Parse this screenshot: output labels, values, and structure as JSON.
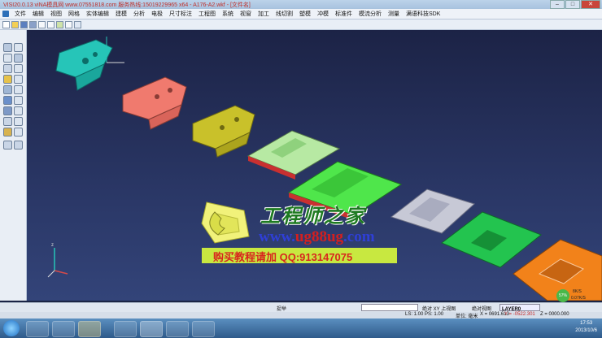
{
  "window": {
    "title": "VISI20.0.13 viNA模具网 www.07551818.com 服务热线:15019229965 x64 - A176-A2.wkf - [文件名]"
  },
  "menu": [
    "文件",
    "编辑",
    "视图",
    "网格",
    "实体编辑",
    "建模",
    "分析",
    "电极",
    "尺寸标注",
    "工程图",
    "系统",
    "视窗",
    "加工",
    "线切割",
    "塑模",
    "冲模",
    "标准件",
    "模流分析",
    "测量",
    "满语科技SDK"
  ],
  "watermark": {
    "title": "工程师之家",
    "url_prefix": "www.",
    "url_highlight": "ug88ug",
    "url_suffix": ".com",
    "banner": "购买教程请加 QQ:913147075"
  },
  "status": {
    "mode": "捉举",
    "view_label": "绝对 XY 上视图",
    "ls": "LS: 1.00 PS: 1.00",
    "abs_view": "绝对视图",
    "layer": "LAYER0",
    "units": "单位: 毫米",
    "coord_x": "X = 0691.613",
    "coord_y": "Y = -0522.301",
    "coord_z": "Z = 0000.000"
  },
  "perf": {
    "cpu": "57%",
    "up": "8K/S",
    "down": "0.07K/S"
  },
  "taskbar": {
    "time": "17:53",
    "date": "2013/10/6"
  },
  "colors": {
    "part1": "#26c5b8",
    "part2": "#f07a6e",
    "part3": "#c9c12a",
    "part4": "#b7e9a3",
    "part5": "#4fe64b",
    "part6": "#c7c9d6",
    "part7": "#23c44f",
    "part8": "#f2821a"
  }
}
